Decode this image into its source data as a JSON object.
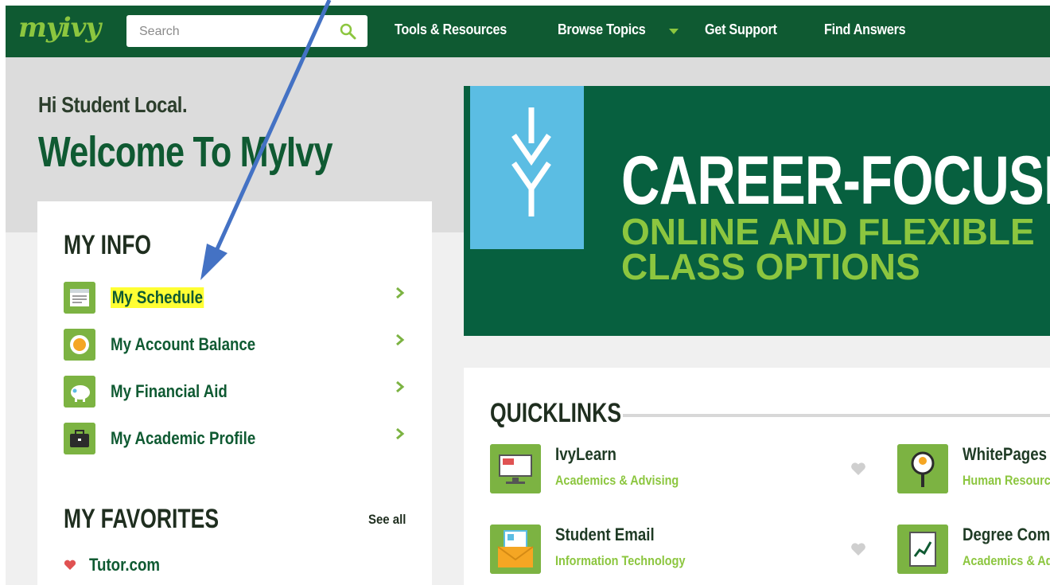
{
  "header": {
    "logo": "myivy",
    "search_placeholder": "Search",
    "nav": [
      "Tools & Resources",
      "Browse Topics",
      "Get Support",
      "Find Answers"
    ]
  },
  "greeting": "Hi Student Local.",
  "welcome": "Welcome To MyIvy",
  "my_info": {
    "title": "MY INFO",
    "items": [
      {
        "label": "My Schedule",
        "icon": "calendar-icon",
        "highlighted": true
      },
      {
        "label": "My Account Balance",
        "icon": "coin-icon",
        "highlighted": false
      },
      {
        "label": "My Financial Aid",
        "icon": "piggy-bank-icon",
        "highlighted": false
      },
      {
        "label": "My Academic Profile",
        "icon": "briefcase-icon",
        "highlighted": false
      }
    ]
  },
  "my_favorites": {
    "title": "MY FAVORITES",
    "see_all": "See all",
    "items": [
      {
        "label": "Tutor.com",
        "icon": "heart-icon"
      }
    ]
  },
  "banner": {
    "headline": "CAREER-FOCUSED",
    "sub1": "ONLINE AND FLEXIBLE",
    "sub2": "CLASS OPTIONS"
  },
  "quicklinks": {
    "title": "QUICKLINKS",
    "items": [
      {
        "name": "IvyLearn",
        "category": "Academics & Advising",
        "icon": "monitor-icon"
      },
      {
        "name": "WhitePages",
        "category": "Human Resources",
        "icon": "magnifier-person-icon"
      },
      {
        "name": "Student Email",
        "category": "Information Technology",
        "icon": "envelope-icon"
      },
      {
        "name": "Degree Compass",
        "category": "Academics & Advising",
        "icon": "chart-book-icon"
      }
    ]
  },
  "colors": {
    "brand_green": "#0f5a32",
    "accent_green": "#8cc63f",
    "banner_blue": "#5bbde3",
    "highlight": "#ffff33",
    "annotation_arrow": "#4472c4"
  }
}
